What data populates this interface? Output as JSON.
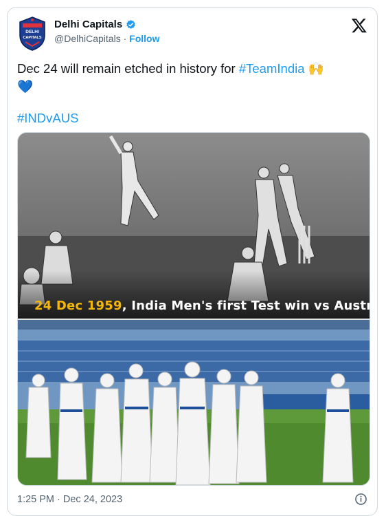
{
  "author": {
    "display_name": "Delhi Capitals",
    "handle": "@DelhiCapitals",
    "separator": " · ",
    "follow_label": "Follow",
    "logo_text_1": "DELHI",
    "logo_text_2": "CAPITALS"
  },
  "tweet": {
    "text_part1": "Dec 24 will remain etched in history for ",
    "hashtag1": "#TeamIndia",
    "emoji1": "🙌",
    "emoji2": "💙",
    "hashtag2": "#INDvAUS"
  },
  "media": {
    "caption_date": "24 Dec 1959",
    "caption_rest": ", India Men's first Test win vs Australia"
  },
  "footer": {
    "timestamp": "1:25 PM · Dec 24, 2023"
  },
  "colors": {
    "accent": "#1d9bf0",
    "caption_date": "#f5b60a"
  },
  "icons": [
    "verified-badge-icon",
    "x-logo-icon",
    "info-icon"
  ]
}
